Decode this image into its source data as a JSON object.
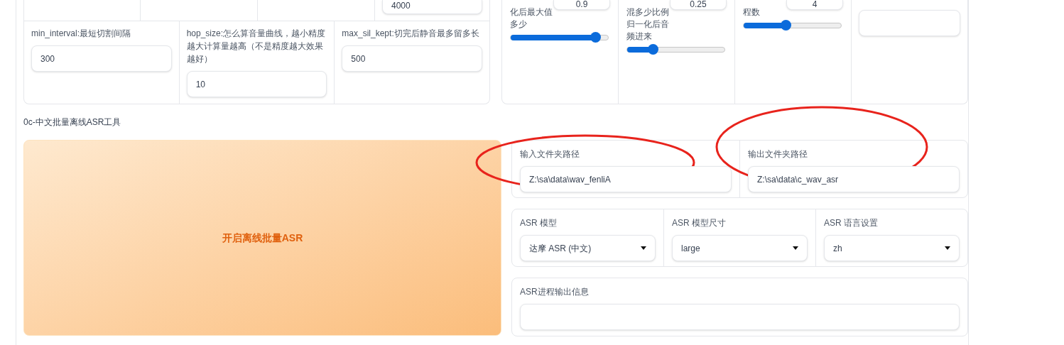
{
  "slicer_params": {
    "top_row_value": "4000",
    "fields": [
      {
        "label": "min_interval:最短切割间隔",
        "value": "300"
      },
      {
        "label": "hop_size:怎么算音量曲线，越小精度越大计算量越高（不是精度越大效果越好）",
        "value": "10"
      },
      {
        "label": "max_sil_kept:切完后静音最多留多长",
        "value": "500"
      }
    ]
  },
  "mix_params": [
    {
      "kind": "slider",
      "label": "化后最大值多少",
      "value": "0.9",
      "level": 0.87
    },
    {
      "kind": "slider",
      "label": "混多少比例归一化后音频进来",
      "value": "0.25",
      "level": 0.26
    },
    {
      "kind": "slider",
      "label": "程数",
      "value": "4",
      "level": 0.43
    },
    {
      "kind": "output"
    }
  ],
  "asr_section": {
    "title": "0c-中文批量离线ASR工具",
    "button": "开启离线批量ASR",
    "paths": [
      {
        "label": "输入文件夹路径",
        "value": "Z:\\sa\\data\\wav_fenliA"
      },
      {
        "label": "输出文件夹路径",
        "value": "Z:\\sa\\data\\c_wav_asr"
      }
    ],
    "dropdowns": [
      {
        "label": "ASR 模型",
        "value": "达摩 ASR (中文)"
      },
      {
        "label": "ASR 模型尺寸",
        "value": "large"
      },
      {
        "label": "ASR 语言设置",
        "value": "zh"
      }
    ],
    "output": {
      "label": "ASR进程输出信息"
    }
  }
}
